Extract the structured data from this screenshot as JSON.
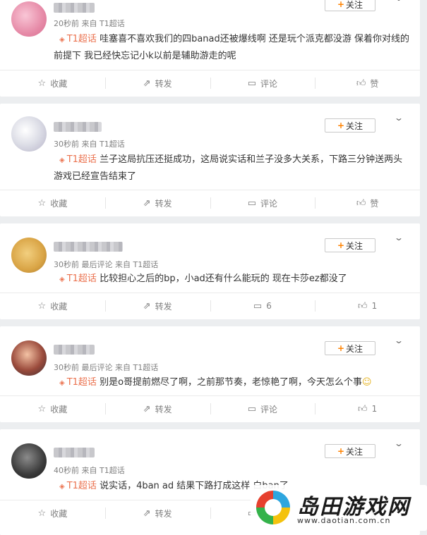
{
  "posts": [
    {
      "time": "20秒前",
      "source": "来自 T1超话",
      "last_comment": "",
      "topic": "T1超话",
      "text": "哇塞喜不喜欢我们的四banad还被爆线啊 还是玩个派克都没游 保着你对线的前提下 我已经快忘记小k以前是辅助游走的呢",
      "follow": "关注",
      "actions": {
        "save": "收藏",
        "repost": "转发",
        "comment": "评论",
        "like": "赞"
      }
    },
    {
      "time": "30秒前",
      "source": "来自 T1超话",
      "last_comment": "",
      "topic": "T1超话",
      "text": "兰子这局抗压还挺成功，这局说实话和兰子没多大关系，下路三分钟送两头游戏已经宣告结束了",
      "follow": "关注",
      "actions": {
        "save": "收藏",
        "repost": "转发",
        "comment": "评论",
        "like": "赞"
      }
    },
    {
      "time": "30秒前",
      "source": "来自 T1超话",
      "last_comment": "最后评论",
      "topic": "T1超话",
      "text": "比较担心之后的bp，小ad还有什么能玩的 现在卡莎ez都没了",
      "follow": "关注",
      "actions": {
        "save": "收藏",
        "repost": "转发",
        "comment": "6",
        "like": "1"
      }
    },
    {
      "time": "30秒前",
      "source": "来自 T1超话",
      "last_comment": "最后评论",
      "topic": "T1超话",
      "text": "别是o哥提前燃尽了啊，之前那节奏，老惊艳了啊，今天怎么个事",
      "follow": "关注",
      "actions": {
        "save": "收藏",
        "repost": "转发",
        "comment": "评论",
        "like": "1"
      }
    },
    {
      "time": "40秒前",
      "source": "来自 T1超话",
      "last_comment": "",
      "topic": "T1超话",
      "text": "说实话，4ban ad 结果下路打成这样 白ban了",
      "follow": "关注",
      "actions": {
        "save": "收藏",
        "repost": "转发",
        "comment": "评论",
        "like": "赞"
      }
    }
  ],
  "watermark": {
    "title": "岛田游戏网",
    "url": "www.daotian.com.cn"
  },
  "colors": {
    "accent": "#ff8200",
    "topic": "#eb7350",
    "background": "#eceef0"
  }
}
